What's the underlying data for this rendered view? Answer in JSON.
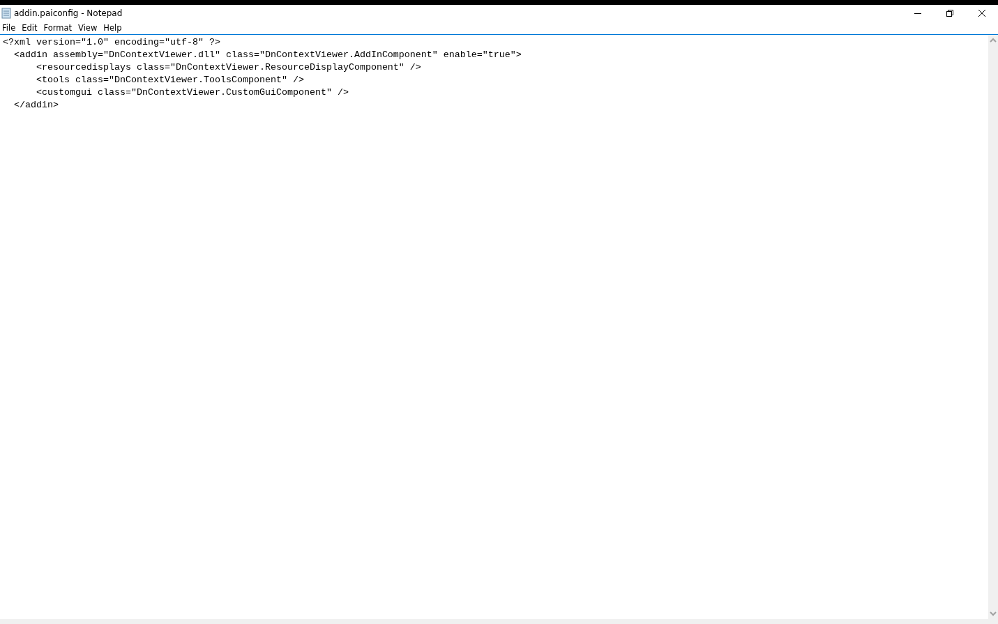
{
  "window": {
    "title": "addin.paiconfig - Notepad"
  },
  "menu": [
    {
      "label": "File"
    },
    {
      "label": "Edit"
    },
    {
      "label": "Format"
    },
    {
      "label": "View"
    },
    {
      "label": "Help"
    }
  ],
  "editor": {
    "lines": [
      "<?xml version=\"1.0\" encoding=\"utf-8\" ?>",
      "  <addin assembly=\"DnContextViewer.dll\" class=\"DnContextViewer.AddInComponent\" enable=\"true\">",
      "      <resourcedisplays class=\"DnContextViewer.ResourceDisplayComponent\" />",
      "      <tools class=\"DnContextViewer.ToolsComponent\" />",
      "      <customgui class=\"DnContextViewer.CustomGuiComponent\" />",
      "  </addin>"
    ]
  }
}
